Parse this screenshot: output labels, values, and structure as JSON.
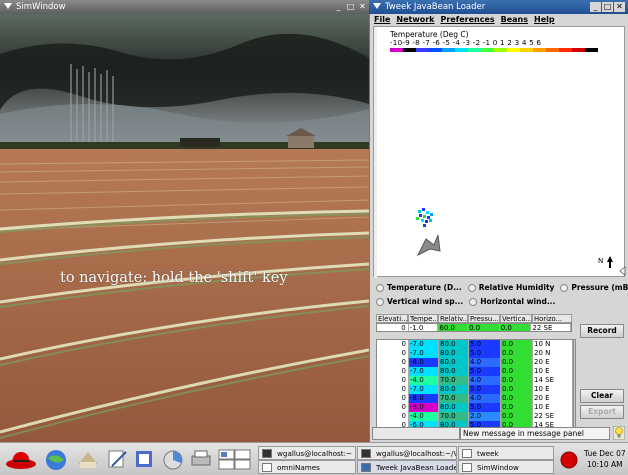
{
  "sim_window": {
    "title": "SimWindow",
    "overlay_text": "to navigate: hold the 'shift' key"
  },
  "tweek_window": {
    "title": "Tweek JavaBean Loader",
    "menu": [
      "File",
      "Network",
      "Preferences",
      "Beans",
      "Help"
    ],
    "legend_title": "Temperature (Deg C)",
    "legend_numbers": "-10-9 -8 -7 -6 -5 -4 -3 -2 -1 0  1  2  3  4  5  6",
    "legend_colors": [
      "#d600c8",
      "#000000",
      "#3a3aff",
      "#0050ff",
      "#00a0ff",
      "#00e0ff",
      "#20ffa0",
      "#40ff40",
      "#a0ff00",
      "#ffff00",
      "#ffd000",
      "#ffa000",
      "#ff6a00",
      "#ff2a00",
      "#d00000",
      "#000000"
    ],
    "north_label": "N",
    "radio_options": [
      [
        "Temperature (D...",
        "Relative Humidity",
        "Pressure (mB)"
      ],
      [
        "Vertical wind sp...",
        "Horizontal wind..."
      ]
    ],
    "table_headers": [
      "Elevati...",
      "Tempe...",
      "Relativ...",
      "Pressu...",
      "Vertica...",
      "Horizo..."
    ],
    "current_row": [
      "0",
      "-1.0",
      "60.0",
      "0.0",
      "0.0",
      "22 SE"
    ],
    "rows": [
      [
        "0",
        "-7.0",
        "80.0",
        "5.0",
        "0.0",
        "10 N"
      ],
      [
        "0",
        "-7.0",
        "80.0",
        "5.0",
        "0.0",
        "20 N"
      ],
      [
        "0",
        "-8.0",
        "80.0",
        "4.0",
        "0.0",
        "20 E"
      ],
      [
        "0",
        "-7.0",
        "80.0",
        "5.0",
        "0.0",
        "10 E"
      ],
      [
        "0",
        "-4.0",
        "70.0",
        "4.0",
        "0.0",
        "14 SE"
      ],
      [
        "0",
        "-7.0",
        "80.0",
        "5.0",
        "0.0",
        "10 E"
      ],
      [
        "0",
        "-8.0",
        "70.0",
        "4.0",
        "0.0",
        "20 E"
      ],
      [
        "0",
        "-8.0",
        "80.0",
        "5.0",
        "0.0",
        "10 E"
      ],
      [
        "0",
        "-4.0",
        "70.0",
        "2.0",
        "0.0",
        "22 SE"
      ],
      [
        "0",
        "-6.0",
        "80.0",
        "5.0",
        "0.0",
        "14 SE"
      ]
    ],
    "buttons": {
      "record": "Record",
      "clear": "Clear",
      "export": "Export"
    },
    "status_message": "New message in message panel"
  },
  "taskbar": {
    "tasks": [
      {
        "label": "wgallus@localhost:~"
      },
      {
        "label": "omniNames"
      },
      {
        "label": "wgallus@localhost:~/Vir"
      },
      {
        "label": "Tweek JavaBean Loader"
      },
      {
        "label": "tweek"
      },
      {
        "label": "SimWindow"
      }
    ],
    "clock_date": "Tue Dec 07",
    "clock_time": "10:10 AM"
  },
  "colors": {
    "active_title": "#1f4f92",
    "inactive_title": "#6a6a6a",
    "temp_cold": "#00e0ff",
    "humidity": "#00c8c8",
    "pressure": "#1a3aff",
    "vertical": "#33dd33"
  }
}
